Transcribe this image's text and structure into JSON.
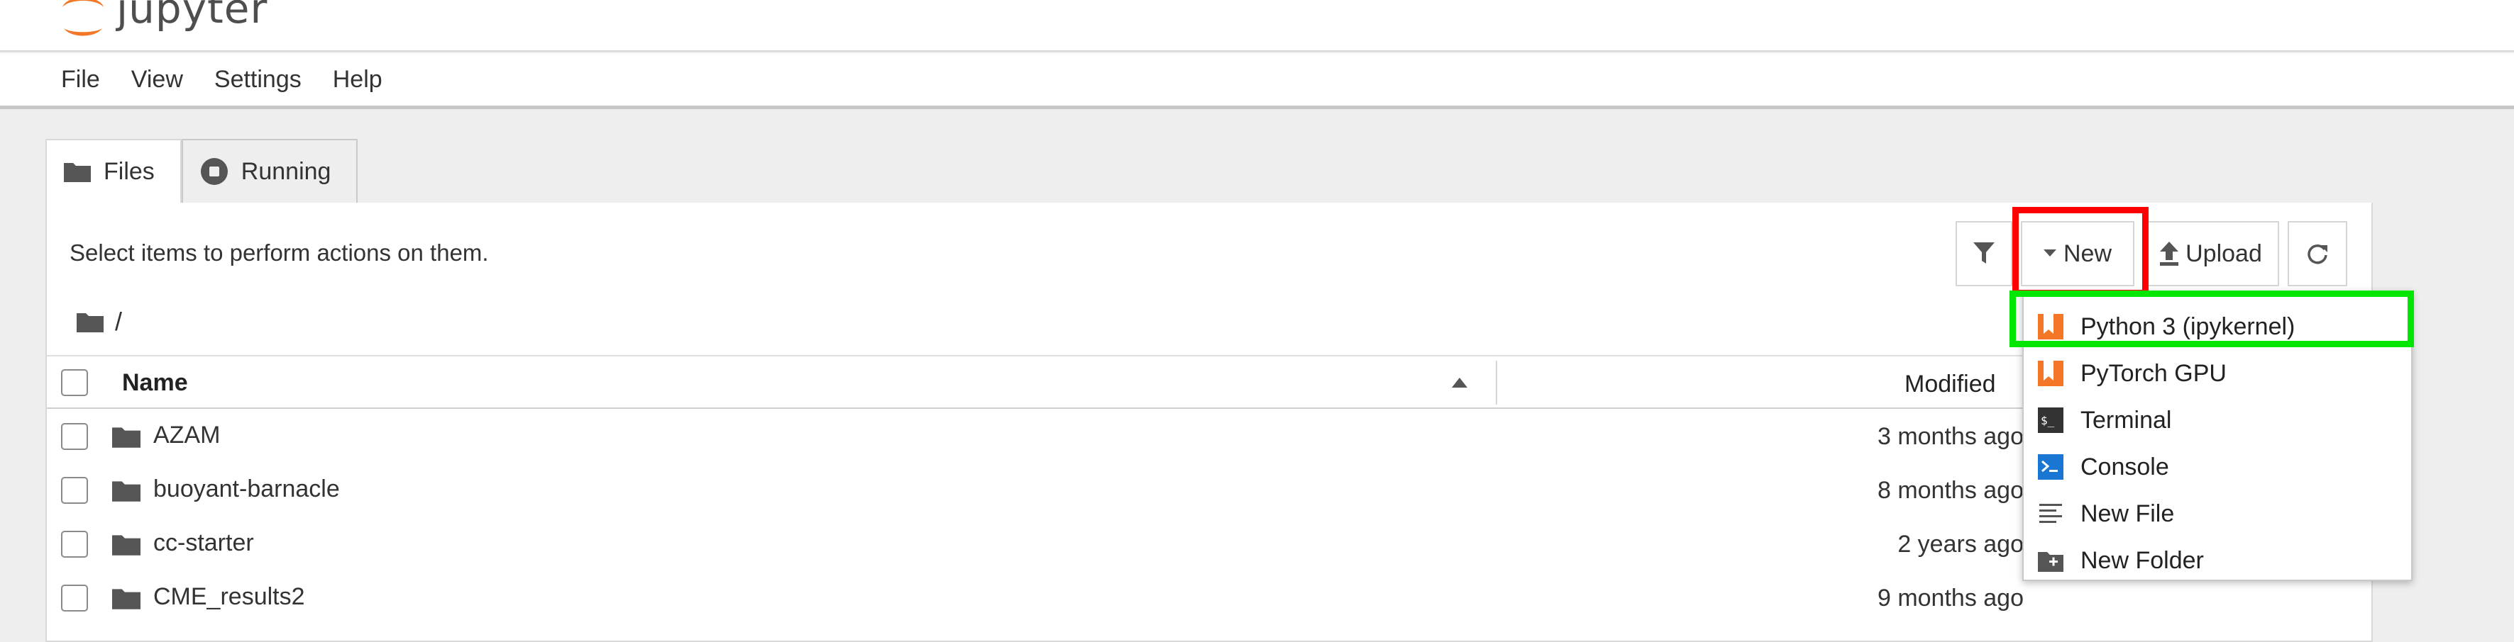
{
  "app": {
    "logo_text": "jupyter"
  },
  "menu": [
    "File",
    "View",
    "Settings",
    "Help"
  ],
  "tabs": [
    {
      "label": "Files",
      "icon": "folder-icon"
    },
    {
      "label": "Running",
      "icon": "stop-circle-icon"
    }
  ],
  "browser": {
    "hint": "Select items to perform actions on them.",
    "breadcrumb": "/",
    "new_label": "New",
    "upload_label": "Upload"
  },
  "columns": {
    "name": "Name",
    "modified": "Modified"
  },
  "files": [
    {
      "name": "AZAM",
      "modified": "3 months ago"
    },
    {
      "name": "buoyant-barnacle",
      "modified": "8 months ago"
    },
    {
      "name": "cc-starter",
      "modified": "2 years ago"
    },
    {
      "name": "CME_results2",
      "modified": "9 months ago"
    }
  ],
  "new_menu": [
    {
      "label": "Python 3 (ipykernel)",
      "icon": "notebook-icon"
    },
    {
      "label": "PyTorch GPU",
      "icon": "notebook-icon"
    },
    {
      "label": "Terminal",
      "icon": "terminal-icon"
    },
    {
      "label": "Console",
      "icon": "console-icon"
    },
    {
      "label": "New File",
      "icon": "text-file-icon"
    },
    {
      "label": "New Folder",
      "icon": "new-folder-icon"
    }
  ],
  "colors": {
    "highlight_red": "#ff0000",
    "highlight_green": "#00e600",
    "jupyter_orange": "#f37726",
    "console_blue": "#1976d2"
  }
}
